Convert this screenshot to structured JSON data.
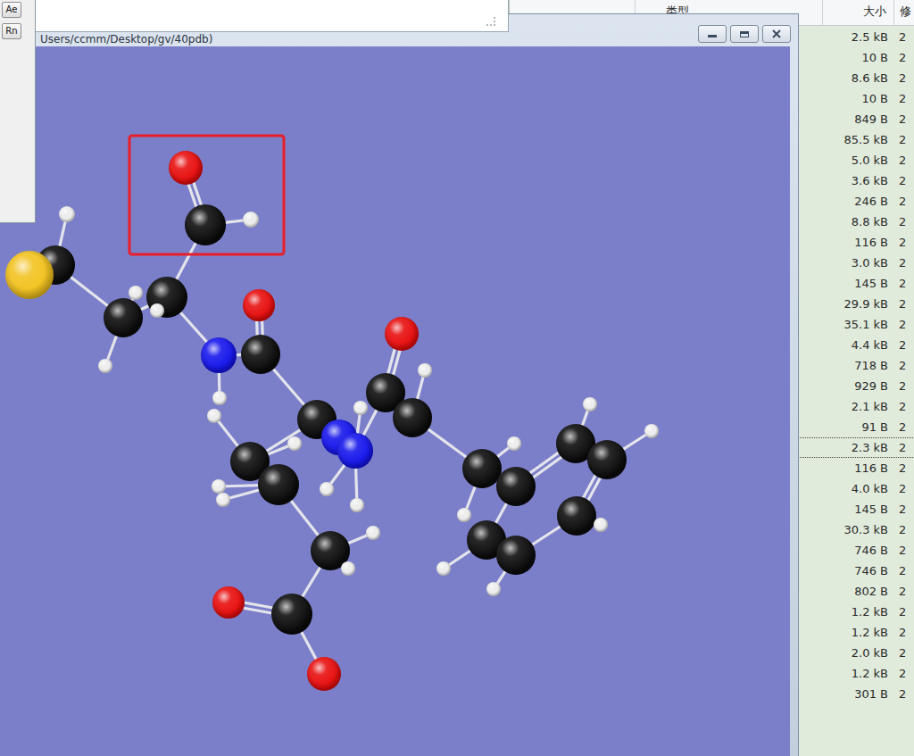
{
  "toolbox": {
    "buttons": [
      {
        "label": "Ae"
      },
      {
        "label": "Rn"
      }
    ]
  },
  "window": {
    "title": "Users/ccmm/Desktop/gv/40pdb)"
  },
  "molecule": {
    "atoms": [
      {
        "kind": "O",
        "color": "#e80c0c",
        "selected": true
      },
      {
        "kind": "C",
        "color": "#0b0b0b",
        "selected": true
      },
      {
        "kind": "H",
        "color": "#ececec",
        "selected": true
      },
      {
        "kind": "H",
        "color": "#ececec",
        "selected": false
      },
      {
        "kind": "C",
        "color": "#0b0b0b",
        "selected": false
      },
      {
        "kind": "S",
        "color": "#f2c21e",
        "selected": false
      },
      {
        "kind": "C",
        "color": "#0b0b0b",
        "selected": false
      },
      {
        "kind": "C",
        "color": "#0b0b0b",
        "selected": false
      },
      {
        "kind": "H",
        "color": "#ececec",
        "selected": false
      },
      {
        "kind": "H",
        "color": "#ececec",
        "selected": false
      },
      {
        "kind": "H",
        "color": "#ececec",
        "selected": false
      },
      {
        "kind": "N",
        "color": "#1414ec",
        "selected": false
      },
      {
        "kind": "H",
        "color": "#ececec",
        "selected": false
      },
      {
        "kind": "C",
        "color": "#0b0b0b",
        "selected": false
      },
      {
        "kind": "O",
        "color": "#e80c0c",
        "selected": false
      },
      {
        "kind": "C",
        "color": "#0b0b0b",
        "selected": false
      },
      {
        "kind": "H",
        "color": "#ececec",
        "selected": false
      },
      {
        "kind": "N",
        "color": "#1414ec",
        "selected": false
      },
      {
        "kind": "N",
        "color": "#1414ec",
        "selected": false
      },
      {
        "kind": "H",
        "color": "#ececec",
        "selected": false
      },
      {
        "kind": "H",
        "color": "#ececec",
        "selected": false
      },
      {
        "kind": "H",
        "color": "#ececec",
        "selected": false
      },
      {
        "kind": "C",
        "color": "#0b0b0b",
        "selected": false
      },
      {
        "kind": "O",
        "color": "#e80c0c",
        "selected": false
      },
      {
        "kind": "C",
        "color": "#0b0b0b",
        "selected": false
      },
      {
        "kind": "H",
        "color": "#ececec",
        "selected": false
      },
      {
        "kind": "C",
        "color": "#0b0b0b",
        "selected": false
      },
      {
        "kind": "C",
        "color": "#0b0b0b",
        "selected": false
      },
      {
        "kind": "C",
        "color": "#0b0b0b",
        "selected": false
      },
      {
        "kind": "C",
        "color": "#0b0b0b",
        "selected": false
      },
      {
        "kind": "C",
        "color": "#0b0b0b",
        "selected": false
      },
      {
        "kind": "C",
        "color": "#0b0b0b",
        "selected": false
      },
      {
        "kind": "C",
        "color": "#0b0b0b",
        "selected": false
      },
      {
        "kind": "H",
        "color": "#ececec",
        "selected": false
      },
      {
        "kind": "H",
        "color": "#ececec",
        "selected": false
      },
      {
        "kind": "H",
        "color": "#ececec",
        "selected": false
      },
      {
        "kind": "H",
        "color": "#ececec",
        "selected": false
      },
      {
        "kind": "H",
        "color": "#ececec",
        "selected": false
      },
      {
        "kind": "H",
        "color": "#ececec",
        "selected": false
      },
      {
        "kind": "H",
        "color": "#ececec",
        "selected": false
      },
      {
        "kind": "C",
        "color": "#0b0b0b",
        "selected": false
      },
      {
        "kind": "C",
        "color": "#0b0b0b",
        "selected": false
      },
      {
        "kind": "H",
        "color": "#ececec",
        "selected": false
      },
      {
        "kind": "H",
        "color": "#ececec",
        "selected": false
      },
      {
        "kind": "H",
        "color": "#ececec",
        "selected": false
      },
      {
        "kind": "C",
        "color": "#0b0b0b",
        "selected": false
      },
      {
        "kind": "H",
        "color": "#ececec",
        "selected": false
      },
      {
        "kind": "H",
        "color": "#ececec",
        "selected": false
      },
      {
        "kind": "C",
        "color": "#0b0b0b",
        "selected": false
      },
      {
        "kind": "O",
        "color": "#e80c0c",
        "selected": false
      },
      {
        "kind": "O",
        "color": "#e80c0c",
        "selected": false
      }
    ]
  },
  "file_list": {
    "columns": [
      {
        "label": "类型"
      },
      {
        "label": "大小"
      },
      {
        "label": "修"
      }
    ],
    "rows": [
      {
        "size": "2.5 kB",
        "modified": "2",
        "focused": false
      },
      {
        "size": "10 B",
        "modified": "2",
        "focused": false
      },
      {
        "size": "8.6 kB",
        "modified": "2",
        "focused": false
      },
      {
        "size": "10 B",
        "modified": "2",
        "focused": false
      },
      {
        "size": "849 B",
        "modified": "2",
        "focused": false
      },
      {
        "size": "85.5 kB",
        "modified": "2",
        "focused": false
      },
      {
        "size": "5.0 kB",
        "modified": "2",
        "focused": false
      },
      {
        "size": "3.6 kB",
        "modified": "2",
        "focused": false
      },
      {
        "size": "246 B",
        "modified": "2",
        "focused": false
      },
      {
        "size": "8.8 kB",
        "modified": "2",
        "focused": false
      },
      {
        "size": "116 B",
        "modified": "2",
        "focused": false
      },
      {
        "size": "3.0 kB",
        "modified": "2",
        "focused": false
      },
      {
        "size": "145 B",
        "modified": "2",
        "focused": false
      },
      {
        "size": "29.9 kB",
        "modified": "2",
        "focused": false
      },
      {
        "size": "35.1 kB",
        "modified": "2",
        "focused": false
      },
      {
        "size": "4.4 kB",
        "modified": "2",
        "focused": false
      },
      {
        "size": "718 B",
        "modified": "2",
        "focused": false
      },
      {
        "size": "929 B",
        "modified": "2",
        "focused": false
      },
      {
        "size": "2.1 kB",
        "modified": "2",
        "focused": false
      },
      {
        "size": "91 B",
        "modified": "2",
        "focused": false
      },
      {
        "size": "2.3 kB",
        "modified": "2",
        "focused": true
      },
      {
        "size": "116 B",
        "modified": "2",
        "focused": false
      },
      {
        "size": "4.0 kB",
        "modified": "2",
        "focused": false
      },
      {
        "size": "145 B",
        "modified": "2",
        "focused": false
      },
      {
        "size": "30.3 kB",
        "modified": "2",
        "focused": false
      },
      {
        "size": "746 B",
        "modified": "2",
        "focused": false
      },
      {
        "size": "746 B",
        "modified": "2",
        "focused": false
      },
      {
        "size": "802 B",
        "modified": "2",
        "focused": false
      },
      {
        "size": "1.2 kB",
        "modified": "2",
        "focused": false
      },
      {
        "size": "1.2 kB",
        "modified": "2",
        "focused": false
      },
      {
        "size": "2.0 kB",
        "modified": "2",
        "focused": false
      },
      {
        "size": "1.2 kB",
        "modified": "2",
        "focused": false
      },
      {
        "size": "301 B",
        "modified": "2",
        "focused": false
      }
    ]
  }
}
